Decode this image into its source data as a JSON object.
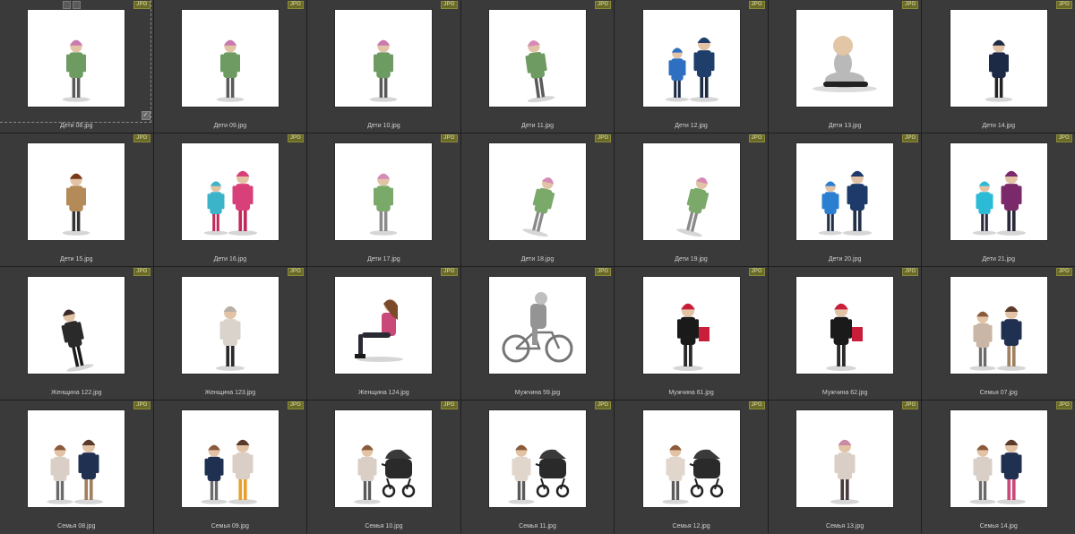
{
  "badge_label": "JPG",
  "items": [
    {
      "label": "Дети 08.jpg",
      "kind": "child",
      "colors": [
        "#6d9b62",
        "#c978b0",
        "#5a5a5a"
      ]
    },
    {
      "label": "Дети 09.jpg",
      "kind": "child",
      "colors": [
        "#6d9b62",
        "#c978b0",
        "#5a5a5a"
      ]
    },
    {
      "label": "Дети 10.jpg",
      "kind": "child",
      "colors": [
        "#6d9b62",
        "#c978b0",
        "#5a5a5a"
      ]
    },
    {
      "label": "Дети 11.jpg",
      "kind": "child-run",
      "colors": [
        "#6d9b62",
        "#d68ab5",
        "#5a5a5a"
      ]
    },
    {
      "label": "Дети 12.jpg",
      "kind": "two-kids",
      "colors": [
        "#2f6fc2",
        "#1f3e6a",
        "#1c2a44"
      ]
    },
    {
      "label": "Дети 13.jpg",
      "kind": "baby",
      "colors": [
        "#b9b9b9",
        "#e2c6a5",
        "#222222"
      ]
    },
    {
      "label": "Дети 14.jpg",
      "kind": "child",
      "colors": [
        "#1d2a45",
        "#1d2a45",
        "#222222"
      ]
    },
    {
      "label": "Дети 15.jpg",
      "kind": "child",
      "colors": [
        "#b48a58",
        "#7a3a1a",
        "#333333"
      ]
    },
    {
      "label": "Дети 16.jpg",
      "kind": "two-kids",
      "colors": [
        "#3bb3c9",
        "#d8407a",
        "#c02a5a"
      ]
    },
    {
      "label": "Дети 17.jpg",
      "kind": "child",
      "colors": [
        "#7aa96a",
        "#d68ab5",
        "#8a8a8a"
      ]
    },
    {
      "label": "Дети 18.jpg",
      "kind": "child-bend",
      "colors": [
        "#7aa96a",
        "#d68ab5",
        "#8a8a8a"
      ]
    },
    {
      "label": "Дети 19.jpg",
      "kind": "child-bend",
      "colors": [
        "#7aa96a",
        "#d68ab5",
        "#8a8a8a"
      ]
    },
    {
      "label": "Дети 20.jpg",
      "kind": "two-kids",
      "colors": [
        "#2a7fd0",
        "#1d3a6a",
        "#223047"
      ]
    },
    {
      "label": "Дети 21.jpg",
      "kind": "two-kids",
      "colors": [
        "#2bbbd6",
        "#7a2a6a",
        "#2a2a3a"
      ]
    },
    {
      "label": "Женщина 122.jpg",
      "kind": "woman-bend",
      "colors": [
        "#2a2a2a",
        "#3a2a2a",
        "#1a1a1a"
      ]
    },
    {
      "label": "Женщина 123.jpg",
      "kind": "woman",
      "colors": [
        "#d9d3cc",
        "#b8b0a8",
        "#2a2a2a"
      ]
    },
    {
      "label": "Женщина 124.jpg",
      "kind": "woman-sit",
      "colors": [
        "#c94a78",
        "#2a2a35",
        "#1a1a1a"
      ]
    },
    {
      "label": "Мужчина 59.jpg",
      "kind": "cyclist",
      "colors": [
        "#7a7a7a",
        "#b0b0b0",
        "#555555"
      ]
    },
    {
      "label": "Мужчина 61.jpg",
      "kind": "man",
      "colors": [
        "#1a1a1a",
        "#c81e3a",
        "#2a2a2a"
      ]
    },
    {
      "label": "Мужчина 62.jpg",
      "kind": "man",
      "colors": [
        "#1a1a1a",
        "#c81e3a",
        "#2a2a2a"
      ]
    },
    {
      "label": "Семья 07.jpg",
      "kind": "couple",
      "colors": [
        "#c9b6a6",
        "#1f3050",
        "#a08060"
      ]
    },
    {
      "label": "Семья 08.jpg",
      "kind": "couple",
      "colors": [
        "#d9cfc6",
        "#1f3050",
        "#a08060"
      ]
    },
    {
      "label": "Семья 09.jpg",
      "kind": "couple",
      "colors": [
        "#1f3050",
        "#d9cfc6",
        "#e6a030"
      ]
    },
    {
      "label": "Семья 10.jpg",
      "kind": "stroller",
      "colors": [
        "#d9cfc6",
        "#1f3050",
        "#2a2a2a"
      ]
    },
    {
      "label": "Семья 11.jpg",
      "kind": "stroller",
      "colors": [
        "#e0d6cc",
        "#1f3050",
        "#2a2a2a"
      ]
    },
    {
      "label": "Семья 12.jpg",
      "kind": "stroller",
      "colors": [
        "#e0d6cc",
        "#c94a78",
        "#2a2a2a"
      ]
    },
    {
      "label": "Семья 13.jpg",
      "kind": "woman",
      "colors": [
        "#d9cfc6",
        "#c98aa8",
        "#4a3a3a"
      ]
    },
    {
      "label": "Семья 14.jpg",
      "kind": "couple",
      "colors": [
        "#d9cfc6",
        "#1f3050",
        "#c94a78"
      ]
    }
  ]
}
